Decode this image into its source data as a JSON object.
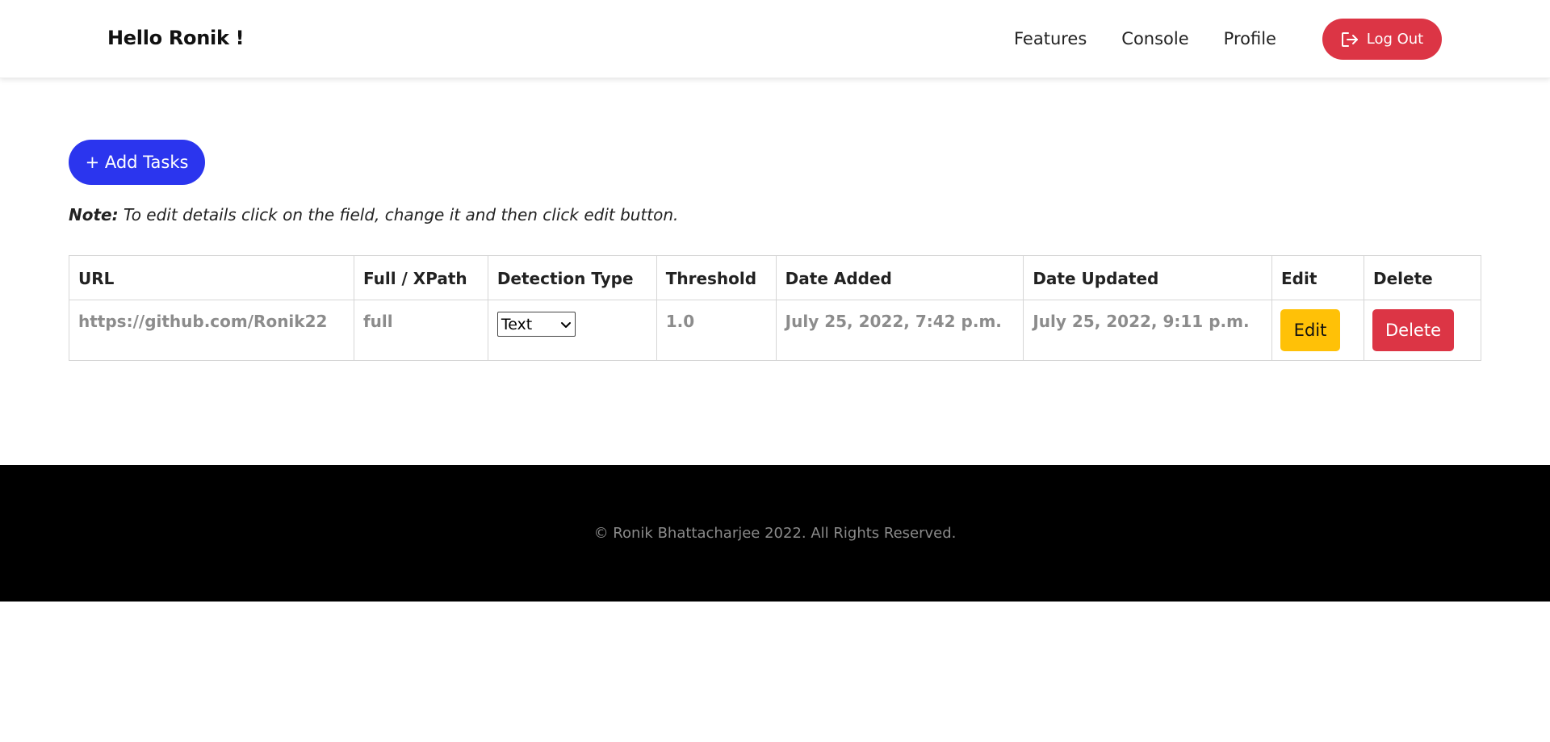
{
  "navbar": {
    "greeting": "Hello Ronik !",
    "links": [
      "Features",
      "Console",
      "Profile"
    ],
    "logout_label": "Log Out"
  },
  "actions": {
    "add_tasks_label": "+ Add Tasks"
  },
  "note": {
    "prefix": "Note:",
    "text": " To edit details click on the field, change it and then click edit button."
  },
  "table": {
    "headers": [
      "URL",
      "Full / XPath",
      "Detection Type",
      "Threshold",
      "Date Added",
      "Date Updated",
      "Edit",
      "Delete"
    ],
    "rows": [
      {
        "url": "https://github.com/Ronik22",
        "path": "full",
        "detection_type": "Text",
        "threshold": "1.0",
        "date_added": "July 25, 2022, 7:42 p.m.",
        "date_updated": "July 25, 2022, 9:11 p.m.",
        "edit_label": "Edit",
        "delete_label": "Delete"
      }
    ]
  },
  "footer": {
    "text": "© Ronik Bhattacharjee 2022. All Rights Reserved."
  },
  "colors": {
    "primary": "#2b35ee",
    "danger": "#dc3545",
    "warning": "#ffc107",
    "footer_bg": "#000000"
  },
  "icons": {
    "logout": "logout-icon",
    "select_chevron": "chevron-down-icon"
  }
}
